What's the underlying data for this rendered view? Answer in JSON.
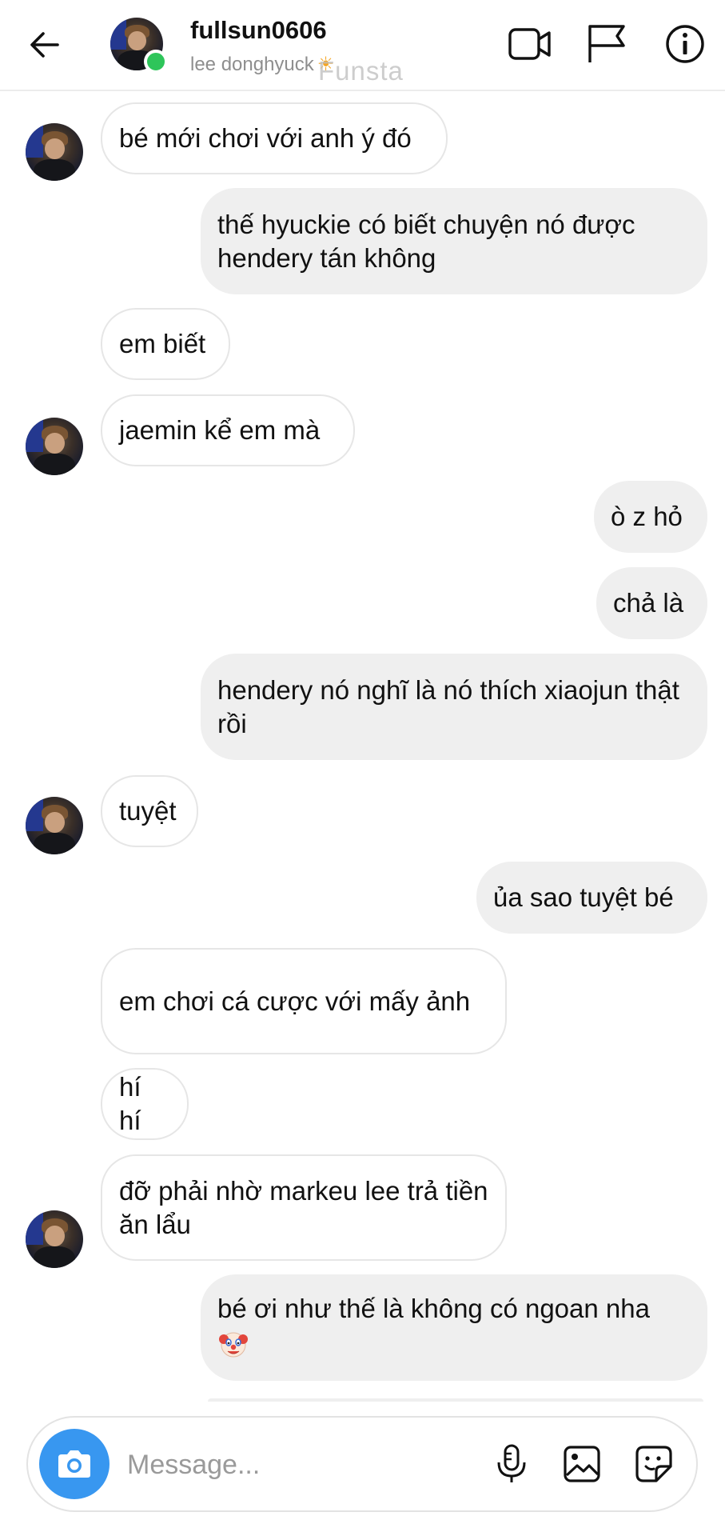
{
  "header": {
    "username": "fullsun0606",
    "subtitle": "lee donghyuck",
    "subtitle_emoji": "☀",
    "watermark": "Funsta"
  },
  "icons": {
    "back": "arrow-left-icon",
    "video": "video-call-icon",
    "report": "flag-icon",
    "info": "info-icon",
    "camera": "camera-icon",
    "mic": "microphone-icon",
    "gallery": "image-icon",
    "sticker": "sticker-icon"
  },
  "messages": [
    {
      "side": "in",
      "text": "bé mới chơi với anh ý đó"
    },
    {
      "side": "out",
      "text": "thế hyuckie có biết chuyện nó được hendery tán không"
    },
    {
      "side": "in",
      "text": "em biết"
    },
    {
      "side": "in",
      "text": "jaemin kể em mà"
    },
    {
      "side": "out",
      "text": "ò z hỏ"
    },
    {
      "side": "out",
      "text": "chả là"
    },
    {
      "side": "out",
      "text": "hendery nó nghĩ là nó thích xiaojun thật rồi"
    },
    {
      "side": "in",
      "text": "tuyệt"
    },
    {
      "side": "out",
      "text": "ủa sao tuyệt bé"
    },
    {
      "side": "in",
      "text": "em chơi cá cược với mấy ảnh"
    },
    {
      "side": "in",
      "text": "hí hí"
    },
    {
      "side": "in",
      "text": "đỡ phải nhờ markeu lee trả tiền ăn lẩu"
    },
    {
      "side": "out",
      "text": "bé ơi như thế là không có ngoan nha",
      "emoji": "clown-face"
    }
  ],
  "composer": {
    "placeholder": "Message..."
  },
  "colors": {
    "accent": "#3897f0",
    "online": "#2ec55a",
    "outgoing_bubble": "#efefef",
    "incoming_border": "#e6e6e6"
  }
}
